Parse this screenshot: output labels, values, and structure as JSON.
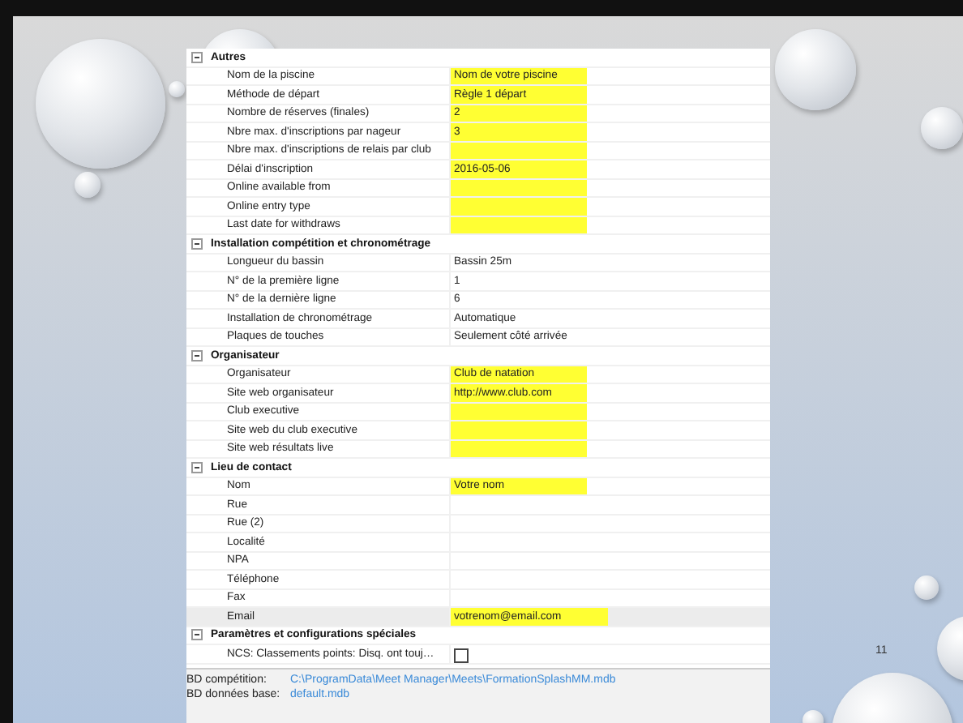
{
  "sections": [
    {
      "title": "Autres",
      "expanded": true,
      "rows": [
        {
          "label": "Nom de la piscine",
          "value": "Nom de votre piscine",
          "highlighted": true,
          "selected": false
        },
        {
          "label": "Méthode de départ",
          "value": "Règle 1 départ",
          "highlighted": true,
          "selected": false
        },
        {
          "label": "Nombre de réserves (finales)",
          "value": "2",
          "highlighted": true,
          "selected": false
        },
        {
          "label": "Nbre max. d'inscriptions par nageur",
          "value": "3",
          "highlighted": true,
          "selected": false
        },
        {
          "label": "Nbre max. d'inscriptions de relais par club",
          "highlighted": true,
          "selected": false
        },
        {
          "label": "Délai d'inscription",
          "value": "2016-05-06",
          "highlighted": true,
          "selected": false
        },
        {
          "label": "Online available from",
          "highlighted": true,
          "selected": false
        },
        {
          "label": "Online entry type",
          "highlighted": true,
          "selected": false
        },
        {
          "label": "Last date for withdraws",
          "highlighted": true,
          "selected": false
        }
      ]
    },
    {
      "title": "Installation compétition et chronométrage",
      "expanded": true,
      "rows": [
        {
          "label": "Longueur du bassin",
          "value": "Bassin 25m",
          "highlighted": false,
          "selected": false
        },
        {
          "label": "N° de la première ligne",
          "value": "1",
          "highlighted": false,
          "selected": false
        },
        {
          "label": "N° de la dernière ligne",
          "value": "6",
          "highlighted": false,
          "selected": false
        },
        {
          "label": "Installation de chronométrage",
          "value": "Automatique",
          "highlighted": false,
          "selected": false
        },
        {
          "label": "Plaques de touches",
          "value": "Seulement côté arrivée",
          "highlighted": false,
          "selected": false
        }
      ]
    },
    {
      "title": "Organisateur",
      "expanded": true,
      "rows": [
        {
          "label": "Organisateur",
          "value": "Club de natation",
          "highlighted": true,
          "selected": false
        },
        {
          "label": "Site web organisateur",
          "value": "http://www.club.com",
          "highlighted": true,
          "selected": false
        },
        {
          "label": "Club executive",
          "highlighted": true,
          "selected": false
        },
        {
          "label": "Site web du club executive",
          "highlighted": true,
          "selected": false
        },
        {
          "label": "Site web résultats live",
          "highlighted": true,
          "selected": false
        }
      ]
    },
    {
      "title": "Lieu de contact",
      "expanded": true,
      "rows": [
        {
          "label": "Nom",
          "value": "Votre nom",
          "highlighted": true,
          "selected": false
        },
        {
          "label": "Rue",
          "highlighted": false,
          "selected": false
        },
        {
          "label": "Rue (2)",
          "highlighted": false,
          "selected": false
        },
        {
          "label": "Localité",
          "highlighted": false,
          "selected": false
        },
        {
          "label": "NPA",
          "highlighted": false,
          "selected": false
        },
        {
          "label": "Téléphone",
          "highlighted": false,
          "selected": false
        },
        {
          "label": "Fax",
          "highlighted": false,
          "selected": false
        },
        {
          "label": "Email",
          "value": "votrenom@email.com",
          "highlighted": true,
          "selected": true
        }
      ]
    },
    {
      "title": "Paramètres et configurations spéciales",
      "expanded": true,
      "rows": [
        {
          "label": "NCS: Classements points: Disq. ont touj…",
          "kind": "checkbox",
          "checked": false,
          "selected": false
        }
      ]
    }
  ],
  "footer": [
    {
      "label": "BD compétition:",
      "value": "C:\\ProgramData\\Meet Manager\\Meets\\FormationSplashMM.mdb"
    },
    {
      "label": "BD données base:",
      "value": "default.mdb"
    }
  ],
  "slide_number": "11"
}
